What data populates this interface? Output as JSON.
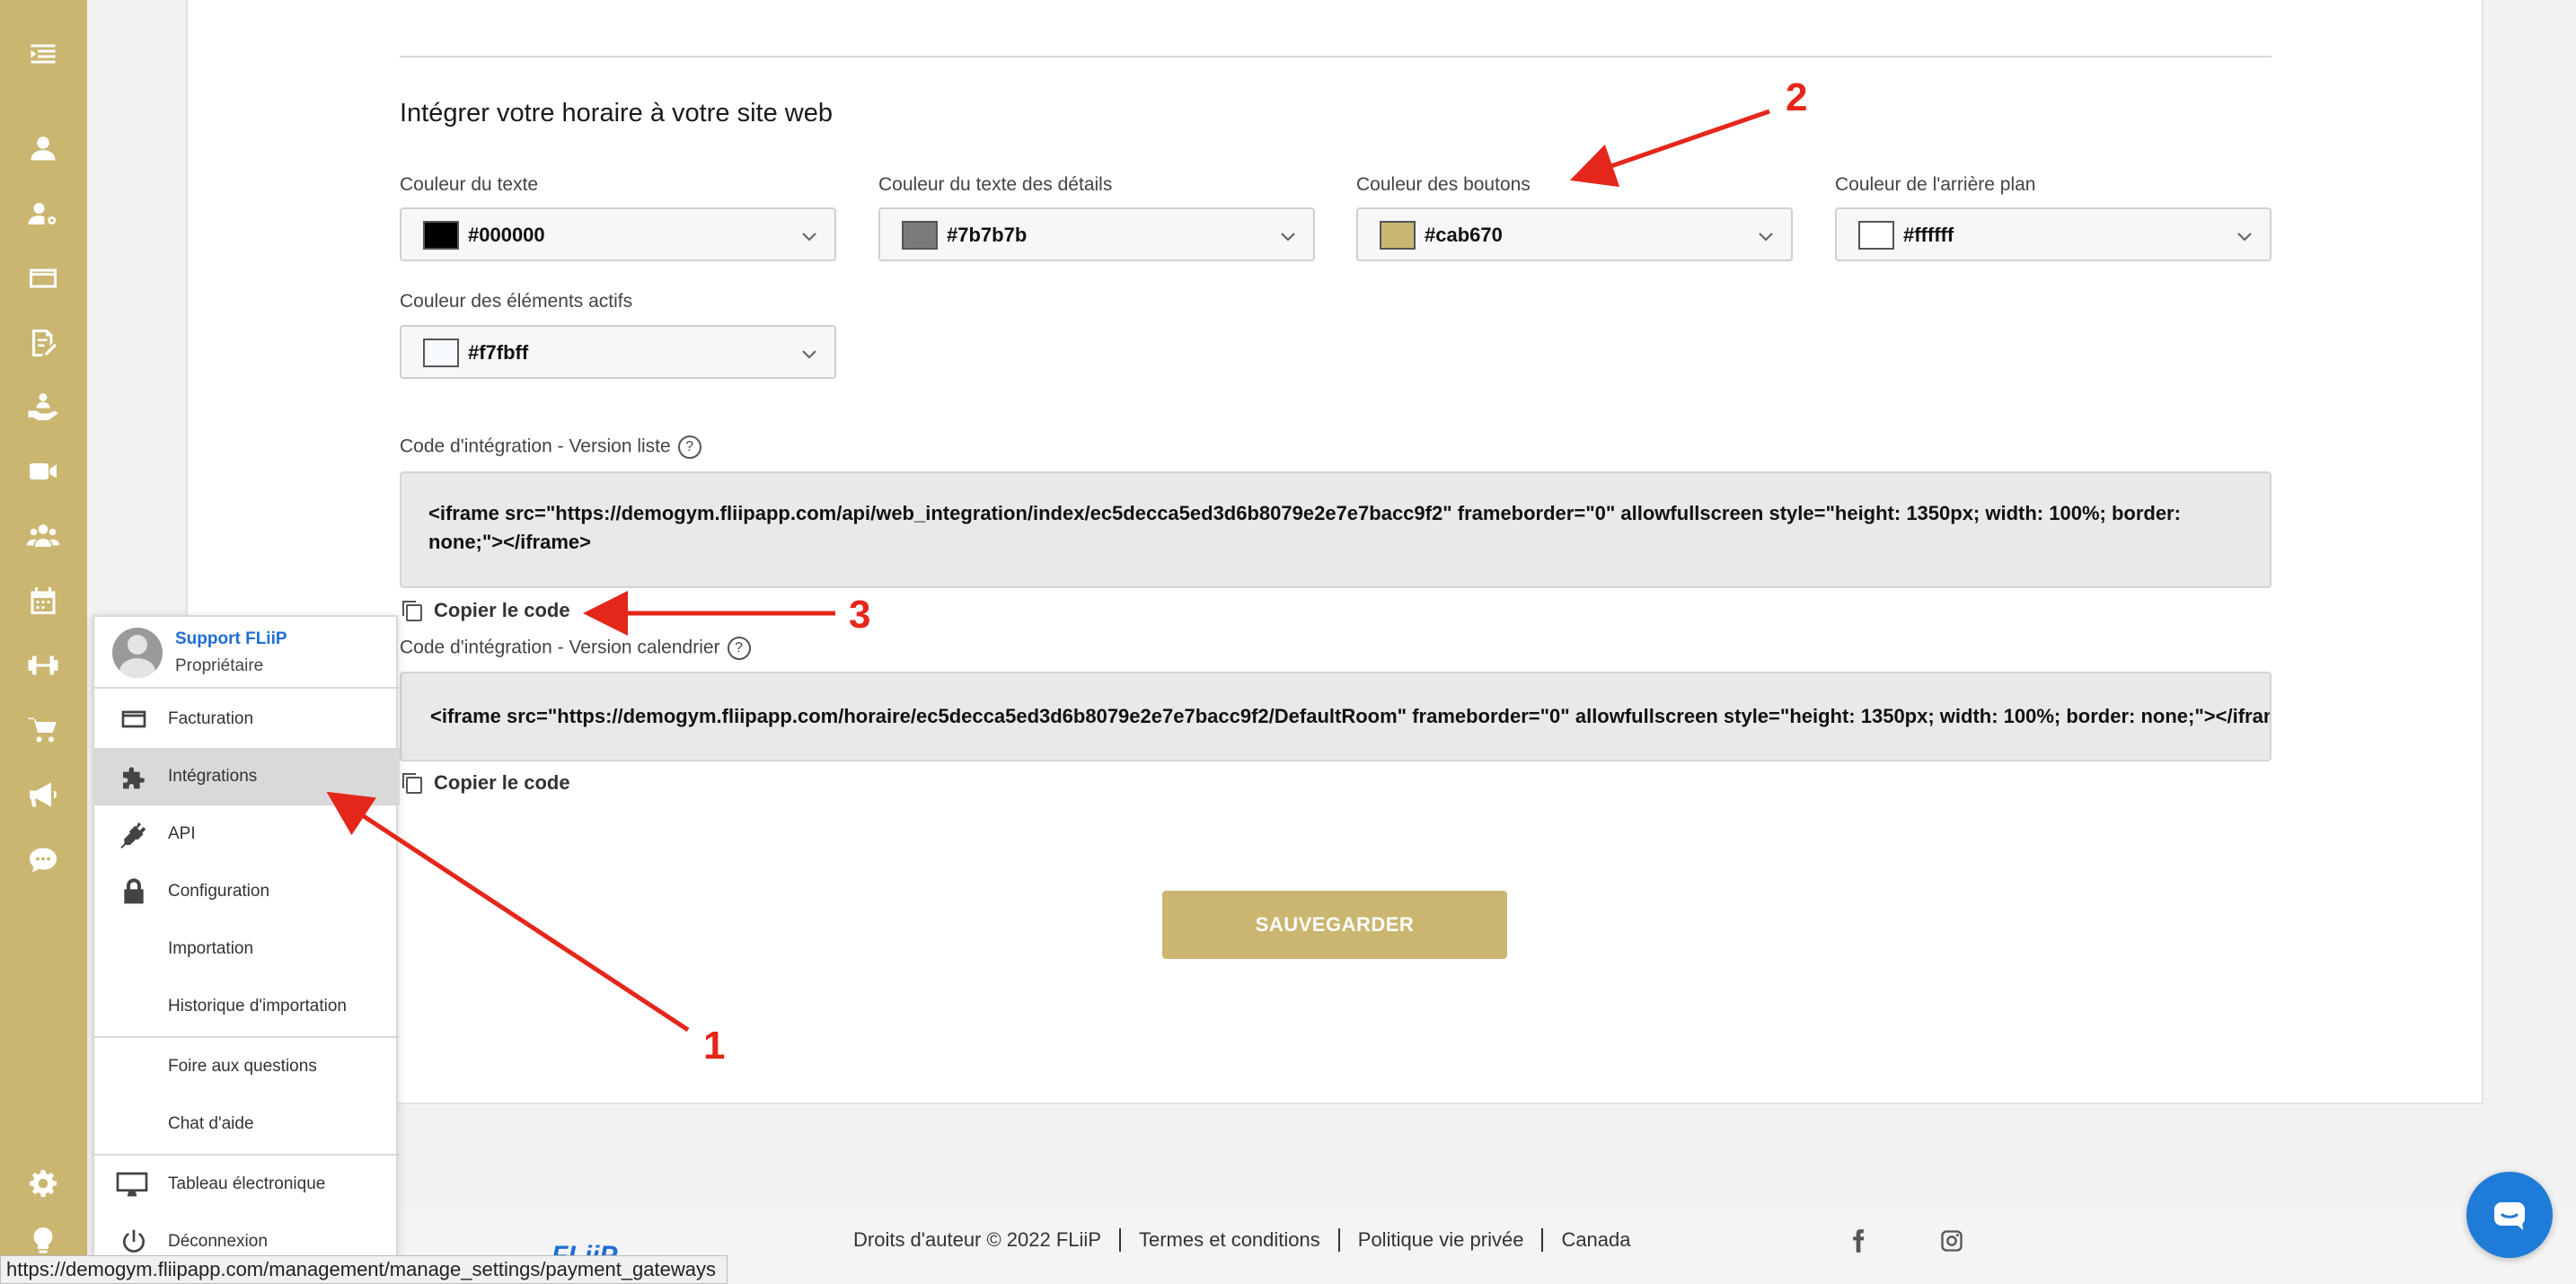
{
  "sidebar": {
    "icons": [
      "menu-collapse-icon",
      "user-icon",
      "user-settings-icon",
      "credit-card-icon",
      "edit-document-icon",
      "hand-holding-user-icon",
      "video-icon",
      "users-group-icon",
      "calendar-icon",
      "dumbbell-icon",
      "cart-icon",
      "megaphone-icon",
      "chat-icon",
      "gear-icon",
      "lightbulb-icon"
    ]
  },
  "integration": {
    "title": "Intégrer votre horaire à votre site web",
    "colors": [
      {
        "label": "Couleur du texte",
        "value": "#000000",
        "swatch": "#000000"
      },
      {
        "label": "Couleur du texte des détails",
        "value": "#7b7b7b",
        "swatch": "#7b7b7b"
      },
      {
        "label": "Couleur des boutons",
        "value": "#cab670",
        "swatch": "#cab670"
      },
      {
        "label": "Couleur de l'arrière plan",
        "value": "#ffffff",
        "swatch": "#ffffff"
      },
      {
        "label": "Couleur des éléments actifs",
        "value": "#f7fbff",
        "swatch": "#f7fbff"
      }
    ],
    "list_code": {
      "label": "Code d'intégration - Version liste",
      "help": "?",
      "code": "<iframe src=\"https://demogym.fliipapp.com/api/web_integration/index/ec5decca5ed3d6b8079e2e7e7bacc9f2\" frameborder=\"0\" allowfullscreen style=\"height: 1350px; width: 100%; border: none;\"></iframe>",
      "copy_label": "Copier le code"
    },
    "calendar_code": {
      "label": "Code d'intégration - Version calendrier",
      "help": "?",
      "code": "<iframe src=\"https://demogym.fliipapp.com/horaire/ec5decca5ed3d6b8079e2e7e7bacc9f2/DefaultRoom\" frameborder=\"0\" allowfullscreen style=\"height: 1350px; width: 100%; border: none;\"></iframe>",
      "copy_label": "Copier le code"
    },
    "save_label": "SAUVEGARDER"
  },
  "menu": {
    "user_name": "Support FLiiP",
    "user_role": "Propriétaire",
    "items": [
      {
        "label": "Facturation",
        "icon": "credit-card-icon"
      },
      {
        "label": "Intégrations",
        "icon": "puzzle-icon",
        "active": true
      },
      {
        "label": "API",
        "icon": "plug-icon"
      },
      {
        "label": "Configuration",
        "icon": "lock-icon"
      },
      {
        "label": "Importation",
        "icon": ""
      },
      {
        "label": "Historique d'importation",
        "icon": ""
      },
      {
        "label": "Foire aux questions",
        "icon": ""
      },
      {
        "label": "Chat d'aide",
        "icon": ""
      },
      {
        "label": "Tableau électronique",
        "icon": "monitor-icon"
      },
      {
        "label": "Déconnexion",
        "icon": "power-icon"
      }
    ]
  },
  "footer": {
    "logo": "FLiiP",
    "copyright": "Droits d'auteur © 2022 FLiiP",
    "terms": "Termes et conditions",
    "privacy": "Politique vie privée",
    "country": "Canada"
  },
  "statusbar": {
    "url": "https://demogym.fliipapp.com/management/manage_settings/payment_gateways"
  },
  "annotations": [
    "1",
    "2",
    "3"
  ],
  "theme": {
    "accent": "#cab670",
    "link": "#1e6ed6",
    "annotation": "#e5261a"
  }
}
